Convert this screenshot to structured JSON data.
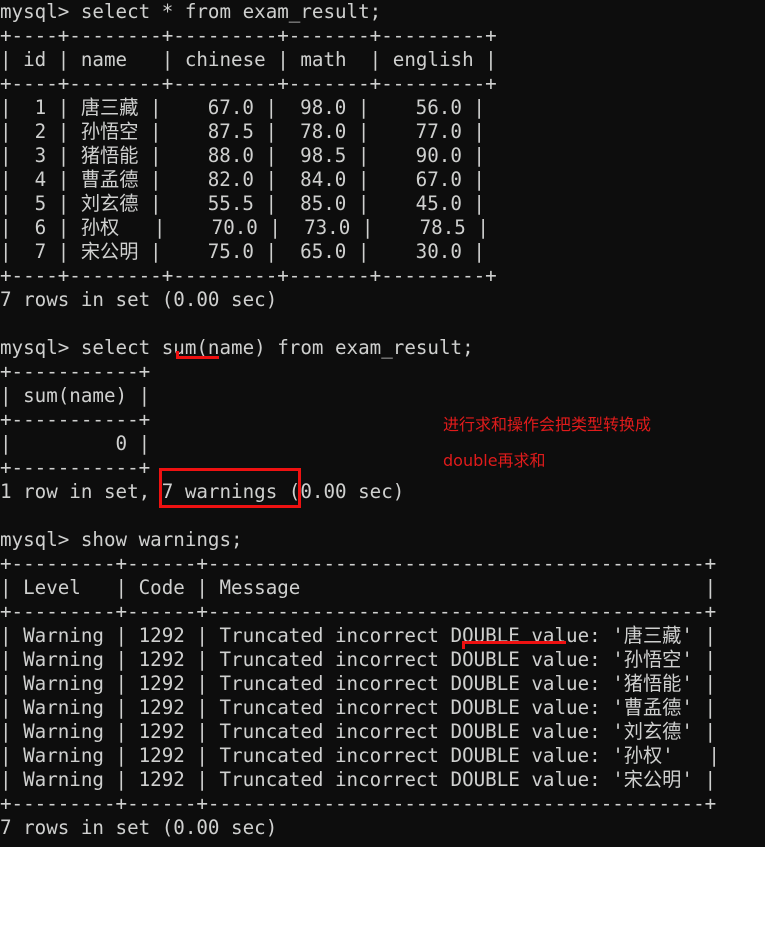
{
  "terminal": {
    "background_color": "#0d0d0d",
    "text_color": "#cfd0cf",
    "annotation_color": "#e01b1b",
    "prompt": "mysql>",
    "query1": "mysql> select * from exam_result;",
    "query2": "mysql> select sum(name) from exam_result;",
    "query3": "mysql> show warnings;",
    "status1": "7 rows in set (0.00 sec)",
    "status2_prefix": "1 row in set, ",
    "status2_highlight": "7 warnings",
    "status2_suffix": " (0.00 sec)",
    "status3": "7 rows in set (0.00 sec)",
    "screen_text": "mysql> select * from exam_result;\n+----+--------+---------+-------+---------+\n| id | name   | chinese | math  | english |\n+----+--------+---------+-------+---------+\n|  1 | 唐三藏 |    67.0 |  98.0 |    56.0 |\n|  2 | 孙悟空 |    87.5 |  78.0 |    77.0 |\n|  3 | 猪悟能 |    88.0 |  98.5 |    90.0 |\n|  4 | 曹孟德 |    82.0 |  84.0 |    67.0 |\n|  5 | 刘玄德 |    55.5 |  85.0 |    45.0 |\n|  6 | 孙权   |    70.0 |  73.0 |    78.5 |\n|  7 | 宋公明 |    75.0 |  65.0 |    30.0 |\n+----+--------+---------+-------+---------+\n7 rows in set (0.00 sec)\n\nmysql> select sum(name) from exam_result;\n+-----------+\n| sum(name) |\n+-----------+\n|         0 |\n+-----------+\n1 row in set, 7 warnings (0.00 sec)\n\nmysql> show warnings;\n+---------+------+-------------------------------------------+\n| Level   | Code | Message                                   |\n+---------+------+-------------------------------------------+\n| Warning | 1292 | Truncated incorrect DOUBLE value: '唐三藏' |\n| Warning | 1292 | Truncated incorrect DOUBLE value: '孙悟空' |\n| Warning | 1292 | Truncated incorrect DOUBLE value: '猪悟能' |\n| Warning | 1292 | Truncated incorrect DOUBLE value: '曹孟德' |\n| Warning | 1292 | Truncated incorrect DOUBLE value: '刘玄德' |\n| Warning | 1292 | Truncated incorrect DOUBLE value: '孙权'   |\n| Warning | 1292 | Truncated incorrect DOUBLE value: '宋公明' |\n+---------+------+-------------------------------------------+\n7 rows in set (0.00 sec)"
  },
  "exam_result_table": {
    "columns": [
      "id",
      "name",
      "chinese",
      "math",
      "english"
    ],
    "rows": [
      {
        "id": "1",
        "name": "唐三藏",
        "chinese": "67.0",
        "math": "98.0",
        "english": "56.0"
      },
      {
        "id": "2",
        "name": "孙悟空",
        "chinese": "87.5",
        "math": "78.0",
        "english": "77.0"
      },
      {
        "id": "3",
        "name": "猪悟能",
        "chinese": "88.0",
        "math": "98.5",
        "english": "90.0"
      },
      {
        "id": "4",
        "name": "曹孟德",
        "chinese": "82.0",
        "math": "84.0",
        "english": "67.0"
      },
      {
        "id": "5",
        "name": "刘玄德",
        "chinese": "55.5",
        "math": "85.0",
        "english": "45.0"
      },
      {
        "id": "6",
        "name": "孙权",
        "chinese": "70.0",
        "math": "73.0",
        "english": "78.5"
      },
      {
        "id": "7",
        "name": "宋公明",
        "chinese": "75.0",
        "math": "65.0",
        "english": "30.0"
      }
    ],
    "row_count_text": "7 rows in set (0.00 sec)"
  },
  "sum_table": {
    "columns": [
      "sum(name)"
    ],
    "rows": [
      {
        "value": "0"
      }
    ],
    "row_count_text": "1 row in set, 7 warnings (0.00 sec)"
  },
  "warnings_table": {
    "columns": [
      "Level",
      "Code",
      "Message"
    ],
    "rows": [
      {
        "level": "Warning",
        "code": "1292",
        "message": "Truncated incorrect DOUBLE value: '唐三藏'"
      },
      {
        "level": "Warning",
        "code": "1292",
        "message": "Truncated incorrect DOUBLE value: '孙悟空'"
      },
      {
        "level": "Warning",
        "code": "1292",
        "message": "Truncated incorrect DOUBLE value: '猪悟能'"
      },
      {
        "level": "Warning",
        "code": "1292",
        "message": "Truncated incorrect DOUBLE value: '曹孟德'"
      },
      {
        "level": "Warning",
        "code": "1292",
        "message": "Truncated incorrect DOUBLE value: '刘玄德'"
      },
      {
        "level": "Warning",
        "code": "1292",
        "message": "Truncated incorrect DOUBLE value: '孙权'"
      },
      {
        "level": "Warning",
        "code": "1292",
        "message": "Truncated incorrect DOUBLE value: '宋公明'"
      }
    ],
    "row_count_text": "7 rows in set (0.00 sec)"
  },
  "annotations": {
    "note_line1": "进行求和操作会把类型转换成",
    "note_line2": "double再求和",
    "highlight_box_label": "7 warnings",
    "underline_sum_target": "sum(",
    "underline_double_target": "DOUBLE"
  }
}
